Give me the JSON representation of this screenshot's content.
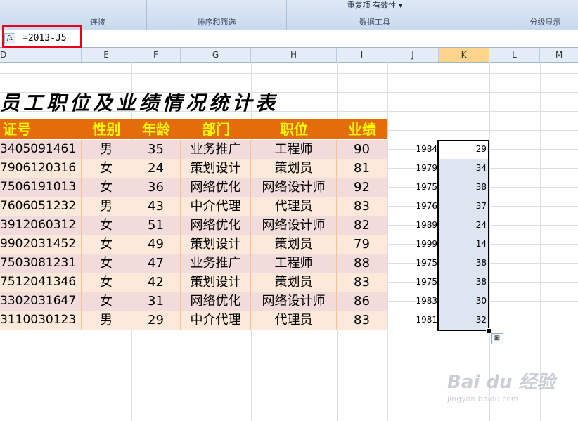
{
  "ribbon": {
    "groups": [
      {
        "label": "连接",
        "top": ""
      },
      {
        "label": "排序和筛选",
        "top": ""
      },
      {
        "label": "数据工具",
        "top": "重复项 有效性 ▾"
      },
      {
        "label": "分级显示",
        "top": ""
      }
    ]
  },
  "formula_bar": {
    "fx_label": "fx",
    "formula": "=2013-J5"
  },
  "columns": [
    "D",
    "E",
    "F",
    "G",
    "H",
    "I",
    "J",
    "K",
    "L",
    "M"
  ],
  "selected_column": "K",
  "sheet_title": "员工职位及业绩情况统计表",
  "table": {
    "headers": [
      "证号",
      "性别",
      "年龄",
      "部门",
      "职位",
      "业绩"
    ],
    "rows": [
      {
        "id": "3405091461",
        "gender": "男",
        "age": "35",
        "dept": "业务推广",
        "position": "工程师",
        "perf": "90",
        "year": "1984",
        "calc": "29"
      },
      {
        "id": "7906120316",
        "gender": "女",
        "age": "24",
        "dept": "策划设计",
        "position": "策划员",
        "perf": "81",
        "year": "1979",
        "calc": "34"
      },
      {
        "id": "7506191013",
        "gender": "女",
        "age": "36",
        "dept": "网络优化",
        "position": "网络设计师",
        "perf": "92",
        "year": "1975",
        "calc": "38"
      },
      {
        "id": "7606051232",
        "gender": "男",
        "age": "43",
        "dept": "中介代理",
        "position": "代理员",
        "perf": "83",
        "year": "1976",
        "calc": "37"
      },
      {
        "id": "3912060312",
        "gender": "女",
        "age": "51",
        "dept": "网络优化",
        "position": "网络设计师",
        "perf": "82",
        "year": "1989",
        "calc": "24"
      },
      {
        "id": "9902031452",
        "gender": "女",
        "age": "49",
        "dept": "策划设计",
        "position": "策划员",
        "perf": "79",
        "year": "1999",
        "calc": "14"
      },
      {
        "id": "7503081231",
        "gender": "女",
        "age": "47",
        "dept": "业务推广",
        "position": "工程师",
        "perf": "88",
        "year": "1975",
        "calc": "38"
      },
      {
        "id": "7512041346",
        "gender": "女",
        "age": "42",
        "dept": "策划设计",
        "position": "策划员",
        "perf": "83",
        "year": "1975",
        "calc": "38"
      },
      {
        "id": "3302031647",
        "gender": "女",
        "age": "31",
        "dept": "网络优化",
        "position": "网络设计师",
        "perf": "86",
        "year": "1983",
        "calc": "30"
      },
      {
        "id": "3110030123",
        "gender": "男",
        "age": "29",
        "dept": "中介代理",
        "position": "代理员",
        "perf": "83",
        "year": "1981",
        "calc": "32"
      }
    ]
  },
  "watermark": {
    "main": "Bai du 经验",
    "sub": "jingyan.baidu.com"
  },
  "colors": {
    "header_bg": "#e46c0a",
    "header_text": "#ffff00",
    "row_odd": "#f2dcdb",
    "row_even": "#fde9d9",
    "highlight": "#e8001c"
  }
}
